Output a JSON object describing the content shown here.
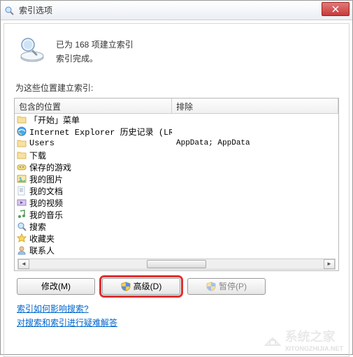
{
  "titlebar": {
    "title": "索引选项"
  },
  "status": {
    "line1": "已为 168 项建立索引",
    "line2": "索引完成。"
  },
  "section_label": "为这些位置建立索引:",
  "columns": {
    "included": "包含的位置",
    "excluded": "排除"
  },
  "rows": [
    {
      "icon": "folder",
      "label": "「开始」菜单",
      "excluded": ""
    },
    {
      "icon": "ie",
      "label": "Internet Explorer 历史记录 (LRG...",
      "excluded": ""
    },
    {
      "icon": "folder",
      "label": "Users",
      "excluded": "AppData; AppData"
    },
    {
      "icon": "folder",
      "label": "下载",
      "excluded": ""
    },
    {
      "icon": "games",
      "label": "保存的游戏",
      "excluded": ""
    },
    {
      "icon": "pictures",
      "label": "我的图片",
      "excluded": ""
    },
    {
      "icon": "documents",
      "label": "我的文档",
      "excluded": ""
    },
    {
      "icon": "videos",
      "label": "我的视频",
      "excluded": ""
    },
    {
      "icon": "music",
      "label": "我的音乐",
      "excluded": ""
    },
    {
      "icon": "search",
      "label": "搜索",
      "excluded": ""
    },
    {
      "icon": "favorites",
      "label": "收藏夹",
      "excluded": ""
    },
    {
      "icon": "contacts",
      "label": "联系人",
      "excluded": ""
    }
  ],
  "buttons": {
    "modify": "修改(M)",
    "advanced": "高级(D)",
    "pause": "暂停(P)"
  },
  "links": {
    "link1": "索引如何影响搜索?",
    "link2": "对搜索和索引进行疑难解答"
  },
  "watermark": {
    "main": "系统之家",
    "sub": "XITONGZHIJIA.NET"
  }
}
